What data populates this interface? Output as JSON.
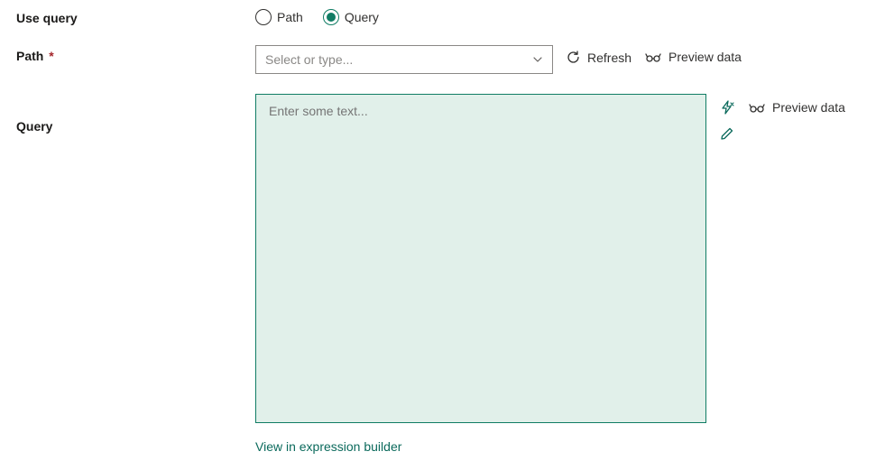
{
  "useQuery": {
    "label": "Use query",
    "options": {
      "path": "Path",
      "query": "Query"
    },
    "selected": "query"
  },
  "path": {
    "label": "Path",
    "required": "*",
    "placeholder": "Select or type...",
    "actions": {
      "refresh": "Refresh",
      "preview": "Preview data"
    }
  },
  "query": {
    "label": "Query",
    "placeholder": "Enter some text...",
    "sideActions": {
      "preview": "Preview data"
    },
    "link": "View in expression builder"
  }
}
